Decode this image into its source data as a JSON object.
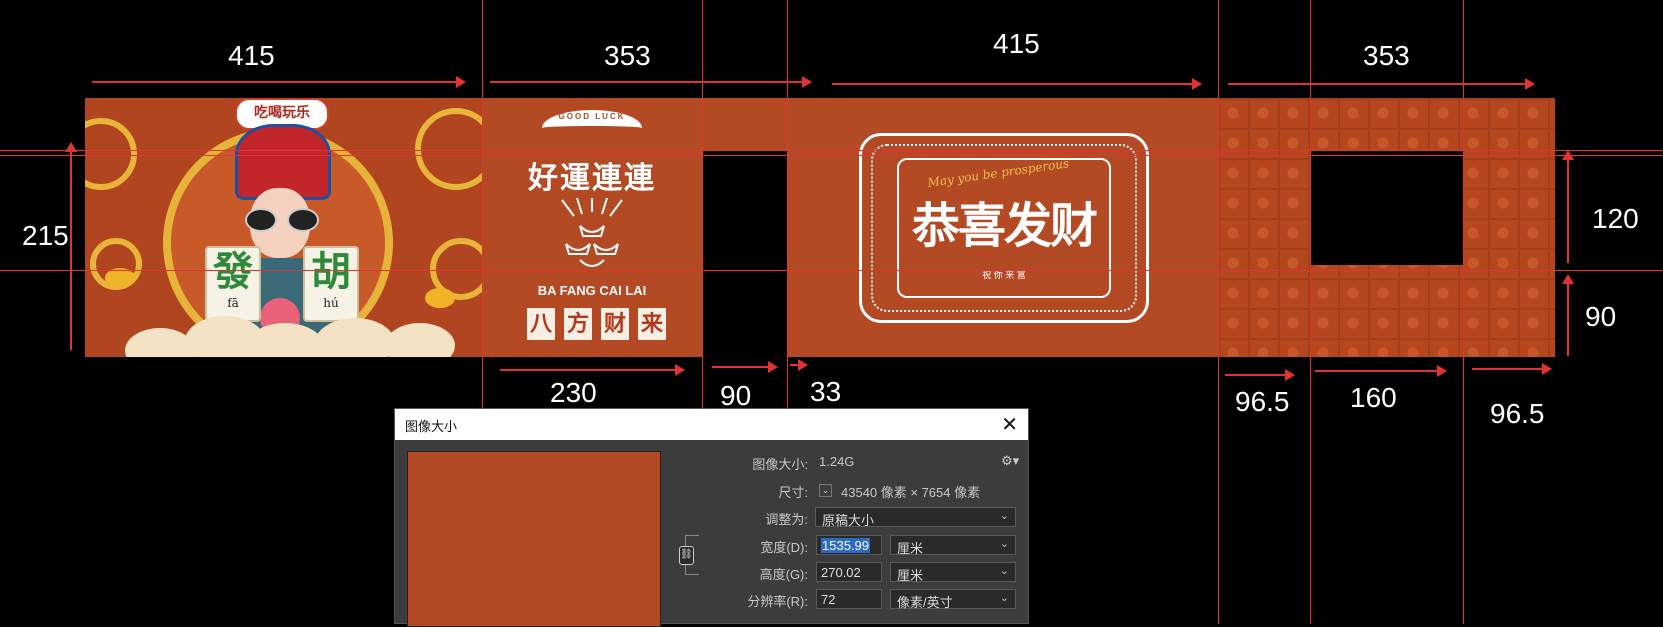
{
  "dimensions": {
    "top": [
      "415",
      "353",
      "415",
      "353"
    ],
    "bottom": [
      "230",
      "90",
      "33",
      "96.5",
      "160",
      "96.5"
    ],
    "left_height": "215",
    "right_heights": [
      "120",
      "90"
    ]
  },
  "artwork": {
    "character_panel": {
      "banner": "吃喝玩乐",
      "tile_left": {
        "char": "發",
        "pinyin": "fā"
      },
      "tile_right": {
        "char": "胡",
        "pinyin": "hú"
      }
    },
    "good_luck_panel": {
      "arch_text": "GOOD LUCK",
      "title": "好運連連",
      "subtitle": "BA FANG CAI LAI",
      "chars": [
        "八",
        "方",
        "财",
        "来"
      ]
    },
    "congrats_panel": {
      "title": "恭喜发财",
      "script": "May you be prosperous",
      "small": "祝 你 来 富"
    }
  },
  "dialog": {
    "title": "图像大小",
    "image_size_label": "图像大小:",
    "image_size_value": "1.24G",
    "dimensions_label": "尺寸:",
    "dimensions_value": "43540 像素 × 7654 像素",
    "fit_label": "调整为:",
    "fit_value": "原稿大小",
    "width_label": "宽度(D):",
    "width_value": "1535.99",
    "width_unit": "厘米",
    "height_label": "高度(G):",
    "height_value": "270.02",
    "height_unit": "厘米",
    "resolution_label": "分辨率(R):",
    "resolution_value": "72",
    "resolution_unit": "像素/英寸"
  },
  "colors": {
    "accent": "#b34a24",
    "guide": "#e03434",
    "tile_green": "#2e8a3a"
  }
}
